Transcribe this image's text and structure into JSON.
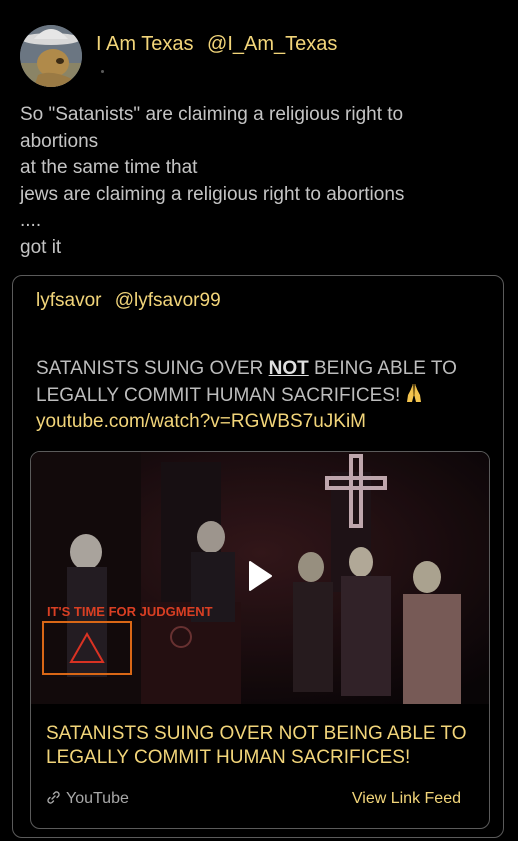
{
  "post": {
    "author_name": "I Am Texas",
    "author_handle": "@I_Am_Texas",
    "avatar_icon": "avatar-cowboy-lizard",
    "text_lines": [
      "So \"Satanists\" are claiming a religious right to",
      "abortions",
      "at the same time that",
      "jews are claiming a religious right to abortions",
      "....",
      "got it"
    ]
  },
  "quote": {
    "author_name": "lyfsavor",
    "author_handle": "@lyfsavor99",
    "text_before": "SATANISTS SUING OVER ",
    "text_strong": "NOT",
    "text_after": " BEING ABLE TO",
    "text_line2": "LEGALLY COMMIT HUMAN SACRIFICES!",
    "emoji_icon": "praying-hands-icon",
    "link": "youtube.com/watch?v=RGWBS7uJKiM"
  },
  "link_card": {
    "thumbnail_icon": "video-thumbnail",
    "play_icon": "play-icon",
    "thumbnail_sign_text": "IT'S TIME FOR JUDGMENT",
    "title_lines": [
      "SATANISTS SUING OVER NOT BEING ABLE TO",
      "LEGALLY COMMIT HUMAN SACRIFICES!"
    ],
    "source": "YouTube",
    "source_icon": "link-icon",
    "view_label": "View Link Feed"
  },
  "colors": {
    "background": "#000000",
    "accent": "#f2d57a",
    "body_text": "#c4c4c4",
    "border": "#5b5b5b"
  }
}
